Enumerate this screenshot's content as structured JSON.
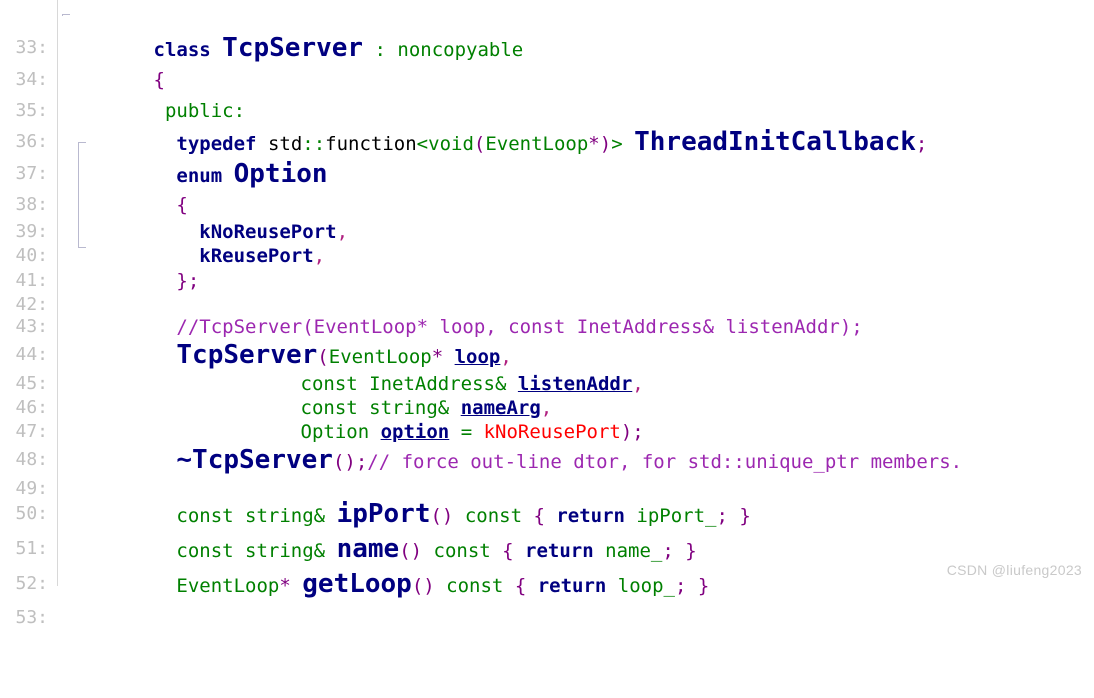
{
  "editor": {
    "language": "C++",
    "background_color": "#ffffff",
    "gutter_color": "#bfbfbf",
    "first_line_number": 33,
    "last_line_number": 53,
    "colors": {
      "keyword": "#000080",
      "type": "#008000",
      "punctuation": "#800080",
      "comment": "#9c27b0",
      "identifier": "#000080",
      "constant_red": "#ff0000",
      "plain": "#000000",
      "line_number": "#bfbfbf"
    }
  },
  "watermark": {
    "text": "CSDN @liufeng2023"
  },
  "lines": [
    {
      "num": "33:",
      "text": "class TcpServer : noncopyable"
    },
    {
      "num": "34:",
      "text": "{"
    },
    {
      "num": "35:",
      "text": " public:"
    },
    {
      "num": "36:",
      "text": "  typedef std::function<void(EventLoop*)> ThreadInitCallback;"
    },
    {
      "num": "37:",
      "text": "  enum Option"
    },
    {
      "num": "38:",
      "text": "  {"
    },
    {
      "num": "39:",
      "text": "    kNoReusePort,"
    },
    {
      "num": "40:",
      "text": "    kReusePort,"
    },
    {
      "num": "41:",
      "text": "  };"
    },
    {
      "num": "42:",
      "text": ""
    },
    {
      "num": "43:",
      "text": "  //TcpServer(EventLoop* loop, const InetAddress& listenAddr);"
    },
    {
      "num": "44:",
      "text": "  TcpServer(EventLoop* loop,"
    },
    {
      "num": "45:",
      "text": "            const InetAddress& listenAddr,"
    },
    {
      "num": "46:",
      "text": "            const string& nameArg,"
    },
    {
      "num": "47:",
      "text": "            Option option = kNoReusePort);"
    },
    {
      "num": "48:",
      "text": "  ~TcpServer();// force out-line dtor, for std::unique_ptr members."
    },
    {
      "num": "49:",
      "text": ""
    },
    {
      "num": "50:",
      "text": "  const string& ipPort() const { return ipPort_; }"
    },
    {
      "num": "51:",
      "text": "  const string& name() const { return name_; }"
    },
    {
      "num": "52:",
      "text": "  EventLoop* getLoop() const { return loop_; }"
    },
    {
      "num": "53:",
      "text": ""
    }
  ],
  "tokens": {
    "l33": {
      "kw_class": "class",
      "name": "TcpServer",
      "colon": " : ",
      "base": "noncopyable"
    },
    "l34": {
      "brace": "{"
    },
    "l35": {
      "access": " public:"
    },
    "l36": {
      "kw": "typedef",
      "std": "std",
      "scope": "::",
      "function": "function",
      "lt": "<",
      "void": "void",
      "lparen": "(",
      "eventloop": "EventLoop",
      "star": "*",
      "rparen": ")",
      "gt": ">",
      "typedef_name": "ThreadInitCallback",
      "semi": ";"
    },
    "l37": {
      "kw": "enum",
      "name": "Option"
    },
    "l38": {
      "brace": "{"
    },
    "l39": {
      "member": "kNoReusePort",
      "comma": ","
    },
    "l40": {
      "member": "kReusePort",
      "comma": ","
    },
    "l41": {
      "brace": "};"
    },
    "l43": {
      "comment": "//TcpServer(EventLoop* loop, const InetAddress& listenAddr);"
    },
    "l44": {
      "ctor": "TcpServer",
      "lparen": "(",
      "type": "EventLoop",
      "star": "*",
      "param": "loop",
      "comma": ","
    },
    "l45": {
      "kw_const": "const ",
      "type": "InetAddress&",
      "param": "listenAddr",
      "comma": ","
    },
    "l46": {
      "kw_const": "const ",
      "type": "string&",
      "param": "nameArg",
      "comma": ","
    },
    "l47": {
      "type": "Option",
      "param": "option",
      "eq": " = ",
      "value": "kNoReusePort",
      "close": ");"
    },
    "l48": {
      "dtor": "~TcpServer",
      "parens": "()",
      "semi": ";",
      "comment": "// force out-line dtor, for std::unique_ptr members."
    },
    "l50": {
      "kw_const": "const ",
      "type": "string& ",
      "method": "ipPort",
      "parens": "()",
      "qual": " const ",
      "obrace": "{",
      "kw_return": " return ",
      "field": "ipPort_",
      "semi": ";",
      "cbrace": " }"
    },
    "l51": {
      "kw_const": "const ",
      "type": "string& ",
      "method": "name",
      "parens": "()",
      "qual": " const ",
      "obrace": "{",
      "kw_return": " return ",
      "field": "name_",
      "semi": ";",
      "cbrace": " }"
    },
    "l52": {
      "type": "EventLoop",
      "star": "*",
      "method": "getLoop",
      "parens": "()",
      "qual": " const ",
      "obrace": "{",
      "kw_return": " return ",
      "field": "loop_",
      "semi": ";",
      "cbrace": " }"
    }
  }
}
